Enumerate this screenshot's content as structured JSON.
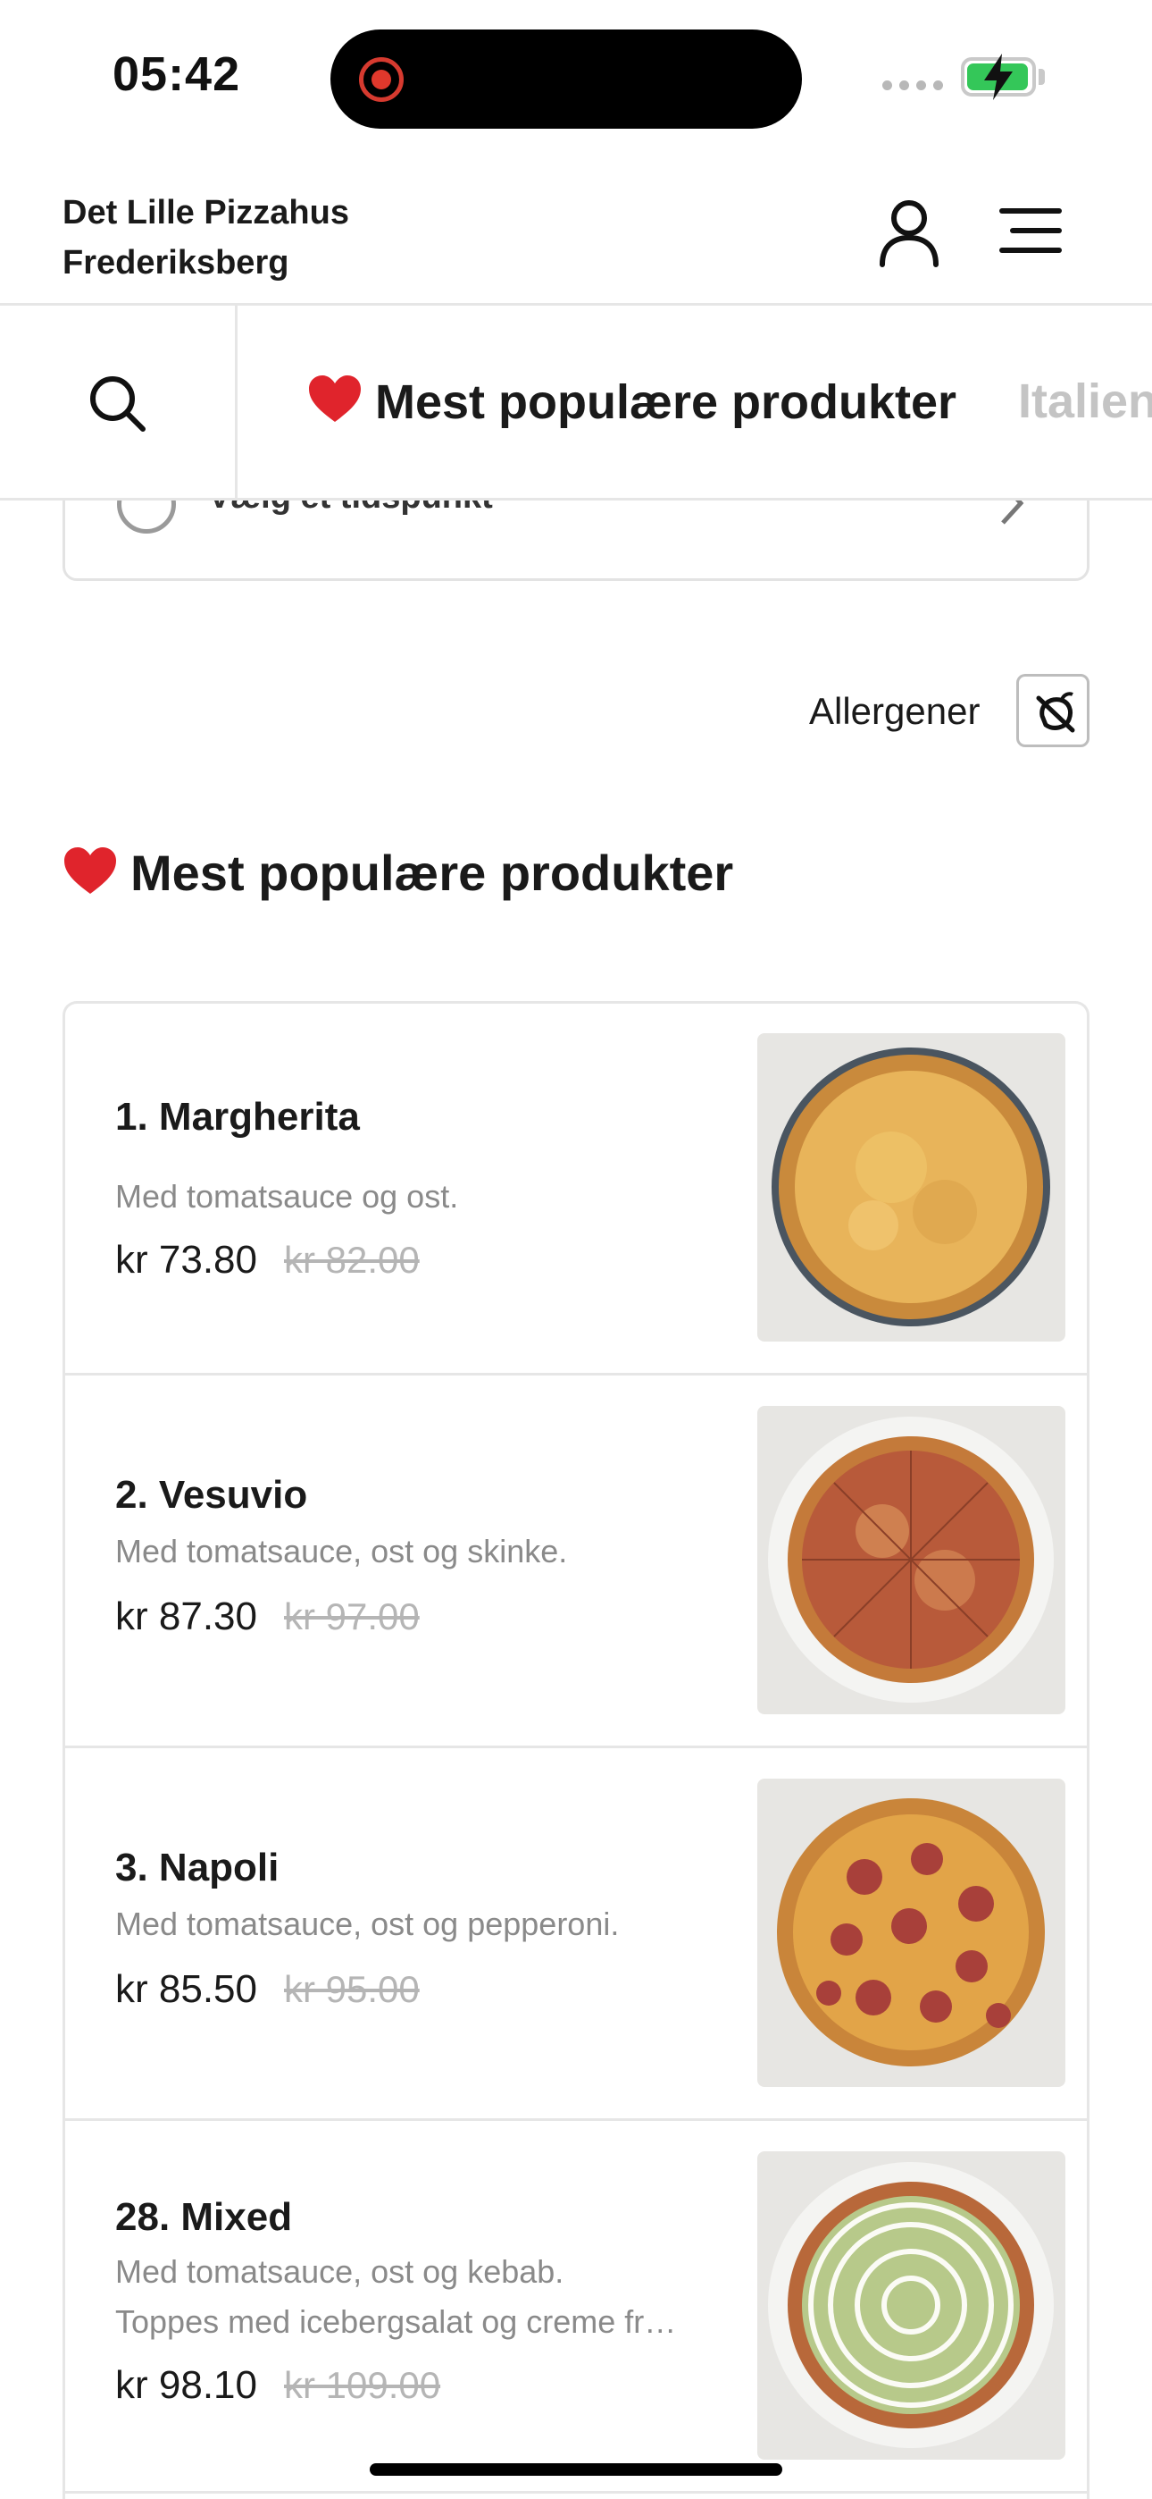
{
  "status_bar": {
    "time": "05:42"
  },
  "header": {
    "store_name_line1": "Det Lille Pizzahus",
    "store_name_line2": "Frederiksberg"
  },
  "category_tabs": [
    {
      "label": "Mest populære produkter",
      "icon": "heart-icon",
      "active": true
    },
    {
      "label": "Italien",
      "active": false
    }
  ],
  "time_picker": {
    "label": "Vælg et tidspunkt"
  },
  "allergens": {
    "label": "Allergener"
  },
  "section": {
    "title": "Mest populære produkter",
    "icon": "heart-icon"
  },
  "products": [
    {
      "name": "1. Margherita",
      "desc_line1": "Med tomatsauce og ost.",
      "desc_line2": "",
      "price": "kr 73.80",
      "old_price": "kr 82.00",
      "image": "margherita-pizza"
    },
    {
      "name": "2. Vesuvio",
      "desc_line1": "Med tomatsauce, ost og skinke.",
      "desc_line2": "",
      "price": "kr 87.30",
      "old_price": "kr 97.00",
      "image": "vesuvio-pizza"
    },
    {
      "name": "3. Napoli",
      "desc_line1": "Med tomatsauce, ost og pepperoni.",
      "desc_line2": "",
      "price": "kr 85.50",
      "old_price": "kr 95.00",
      "image": "napoli-pizza"
    },
    {
      "name": "28. Mixed",
      "desc_line1": "Med tomatsauce, ost og kebab.",
      "desc_line2": "Toppes med icebergsalat og creme fr…",
      "price": "kr 98.10",
      "old_price": "kr 109.00",
      "image": "mixed-pizza"
    }
  ],
  "colors": {
    "heart": "#e0242c",
    "battery": "#34c759",
    "recording": "#e0382c",
    "muted_text": "#8a8a8a"
  }
}
